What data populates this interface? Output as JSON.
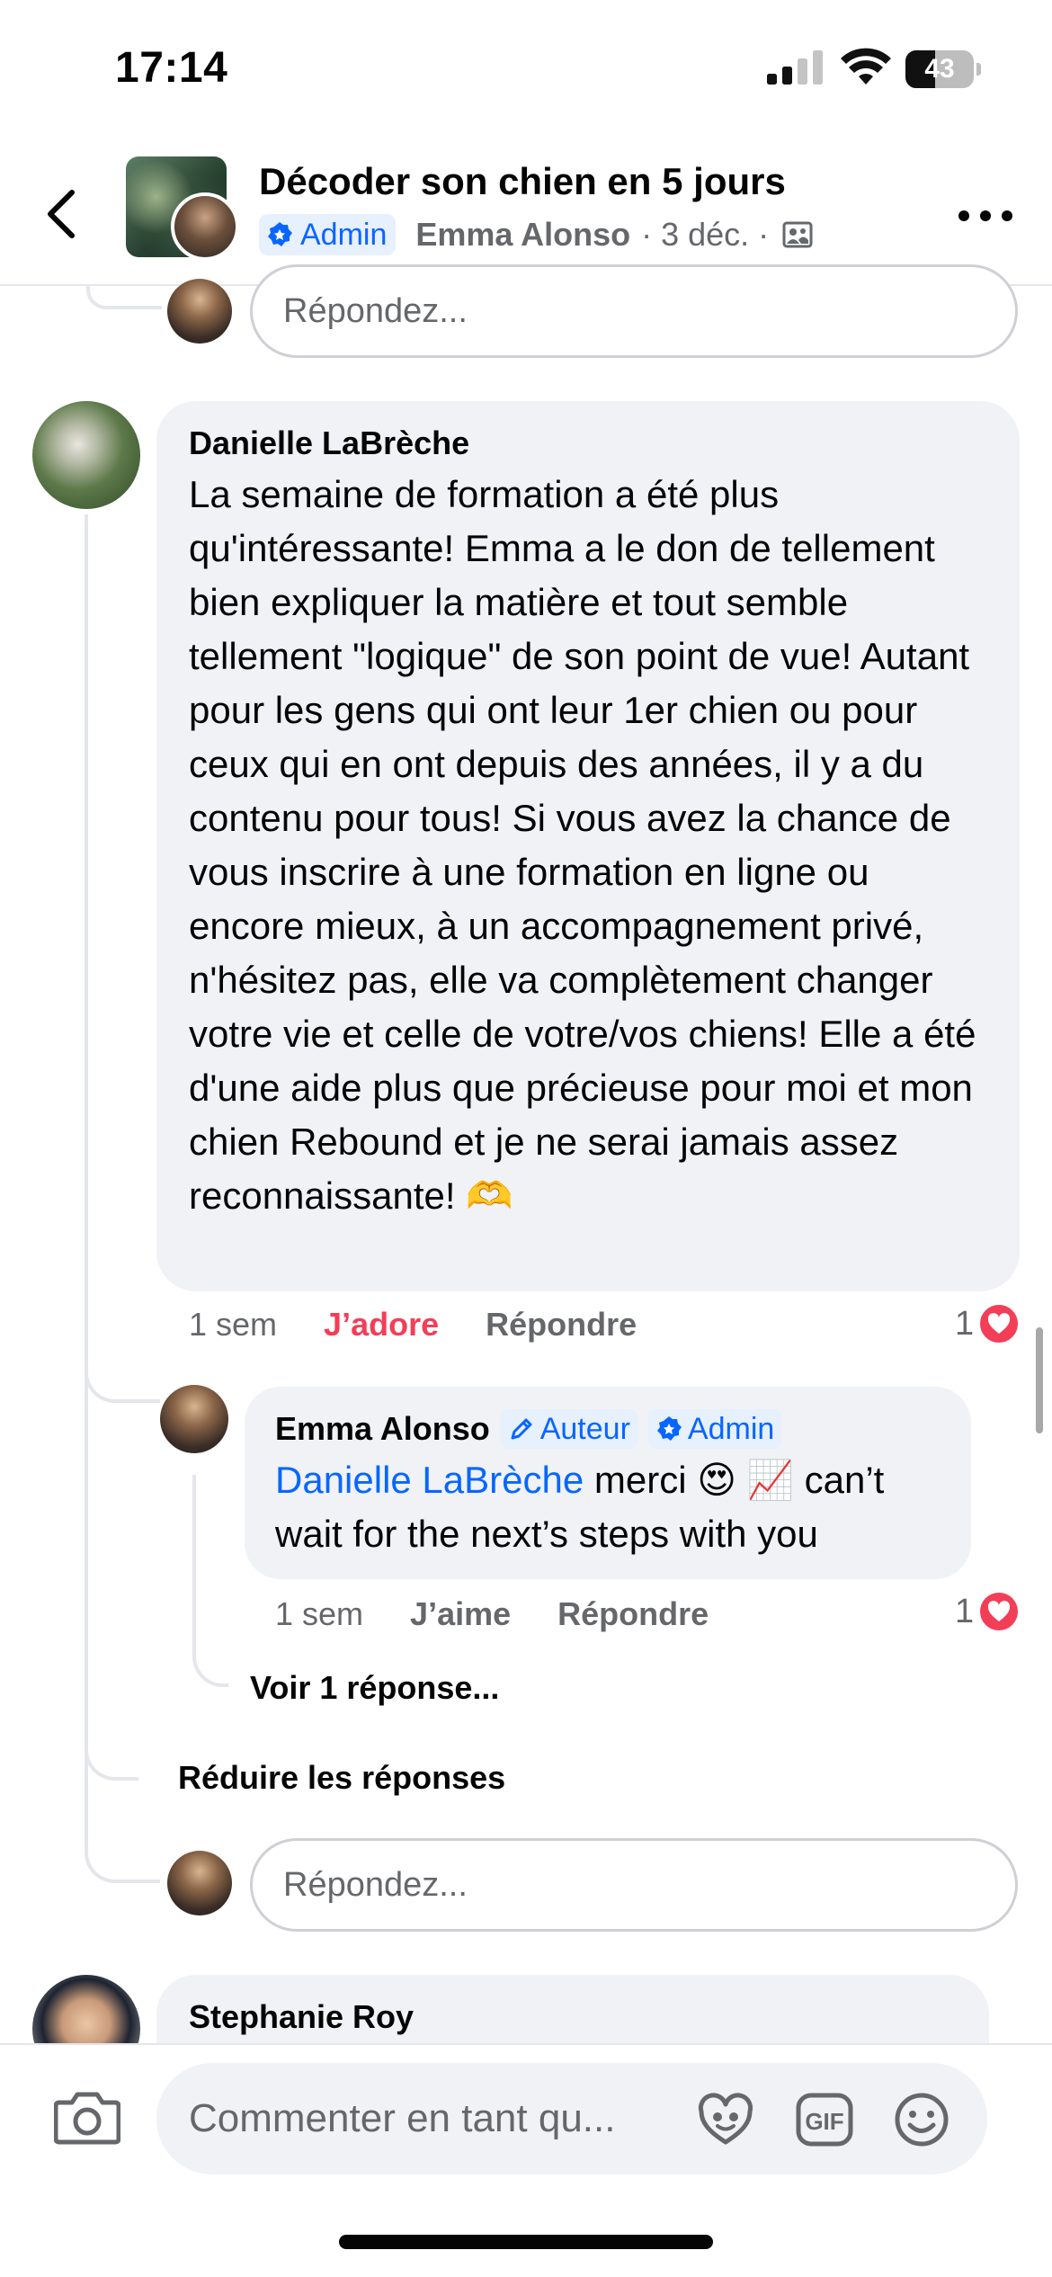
{
  "status_bar": {
    "time": "17:14",
    "battery_level": "43",
    "battery_fraction": 0.43
  },
  "header": {
    "back_icon": "chevron-left-icon",
    "title": "Décoder son chien en 5 jours",
    "admin_label": "Admin",
    "author": "Emma Alonso",
    "date": "· 3 déc. ·",
    "members_icon": "members-icon",
    "more_icon": "more-horizontal-icon"
  },
  "top_reply": {
    "placeholder": "Répondez..."
  },
  "comments": [
    {
      "author": "Danielle LaBrèche",
      "text": "La semaine de formation a été plus qu'intéressante! Emma a le don de tellement bien expliquer la matière et tout semble tellement \"logique\" de son point de vue! Autant pour les gens qui ont leur 1er chien ou pour ceux qui en ont depuis des années, il y a du contenu pour tous! Si vous avez la chance de vous inscrire à une formation en ligne ou encore mieux, à un accompagnement privé,  n'hésitez pas, elle va complètement changer votre vie et celle de votre/vos chiens! Elle a été d'une aide plus que précieuse pour moi et mon chien Rebound et je ne serai jamais assez reconnaissante! 🫶",
      "time": "1 sem",
      "reaction_label": "J’adore",
      "reply_label": "Répondre",
      "reaction_count": "1",
      "reaction_icon": "heart-icon"
    },
    {
      "author": "Emma Alonso",
      "tag_author": "Auteur",
      "tag_admin": "Admin",
      "mention": "Danielle LaBrèche",
      "text": " merci 😍 📈 can’t wait for the next’s steps with you",
      "time": "1 sem",
      "reaction_label": "J’aime",
      "reply_label": "Répondre",
      "reaction_count": "1",
      "reaction_icon": "heart-icon"
    }
  ],
  "see_replies": "Voir 1 réponse...",
  "collapse_replies": "Réduire les réponses",
  "bottom_reply": {
    "placeholder": "Répondez..."
  },
  "next_comment": {
    "author": "Stephanie Roy"
  },
  "composer": {
    "camera_icon": "camera-icon",
    "placeholder": "Commenter en tant qu...",
    "avatar_icon": "avatar-sticker-icon",
    "gif_icon": "gif-icon",
    "emoji_icon": "emoji-icon"
  }
}
